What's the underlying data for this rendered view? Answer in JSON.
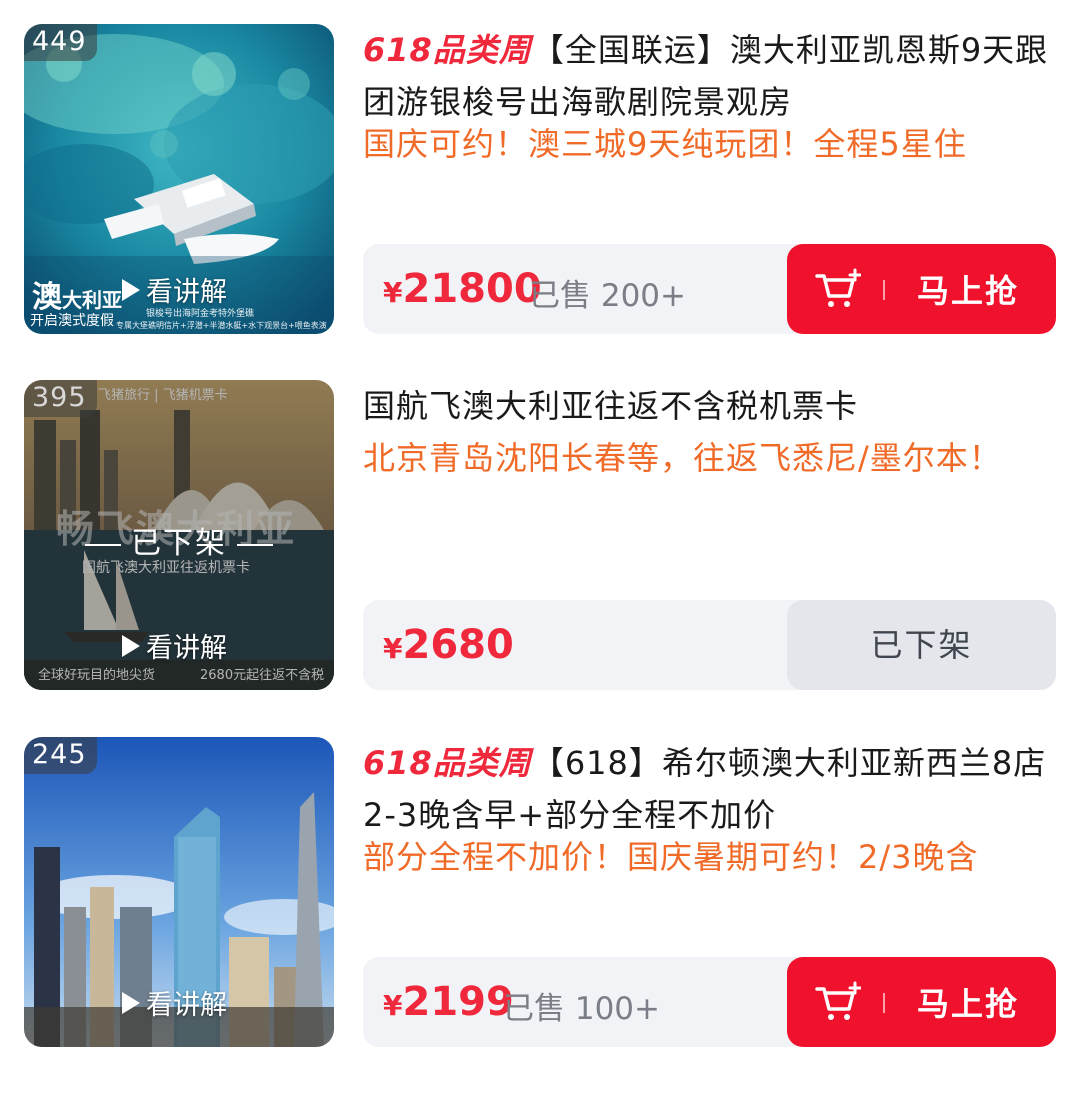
{
  "items": [
    {
      "rank": "449",
      "promo_tag": "618品类周",
      "title": "【全国联运】澳大利亚凯恩斯9天跟团游银梭号出海歌剧院景观房",
      "subtitle": "国庆可约！澳三城9天纯玩团！全程5星住",
      "price_symbol": "¥",
      "price": "21800",
      "sold": "已售 200+",
      "explain": "看讲解",
      "button": "马上抢",
      "image_text": {
        "brand": "澳",
        "brand_rest": "大利亚",
        "slogan": "开启澳式度假",
        "line1": "银梭号出海阿金考特外堡礁",
        "line2": "专属大堡礁明信片+浮潜+半潜水艇+水下观景台+喂鱼表演"
      }
    },
    {
      "rank": "395",
      "promo_tag": "",
      "title": "国航飞澳大利亚往返不含税机票卡",
      "subtitle": "北京青岛沈阳长春等，往返飞悉尼/墨尔本！",
      "price_symbol": "¥",
      "price": "2680",
      "sold": "",
      "explain": "看讲解",
      "button": "已下架",
      "offline_label": "已下架",
      "image_text": {
        "top_brand": "飞猪旅行",
        "top_card": "飞猪机票卡",
        "big": "畅飞澳大利亚",
        "sub": "国航飞澳大利亚往返机票卡",
        "bottom_left": "全球好玩目的地尖货",
        "bottom_right": "2680元起往返不含税"
      }
    },
    {
      "rank": "245",
      "promo_tag": "618品类周",
      "title": "【618】希尔顿澳大利亚新西兰8店2-3晚含早+部分全程不加价",
      "subtitle": "部分全程不加价！国庆暑期可约！2/3晚含",
      "price_symbol": "¥",
      "price": "2199",
      "sold": "已售 100+",
      "explain": "看讲解",
      "button": "马上抢"
    }
  ],
  "colors": {
    "promo_red": "#f0283c",
    "subtitle_orange": "#f06a28",
    "buy_button": "#f0122d",
    "pricebar_bg": "#f2f3f6"
  },
  "icons": [
    "play-icon",
    "cart-icon"
  ]
}
